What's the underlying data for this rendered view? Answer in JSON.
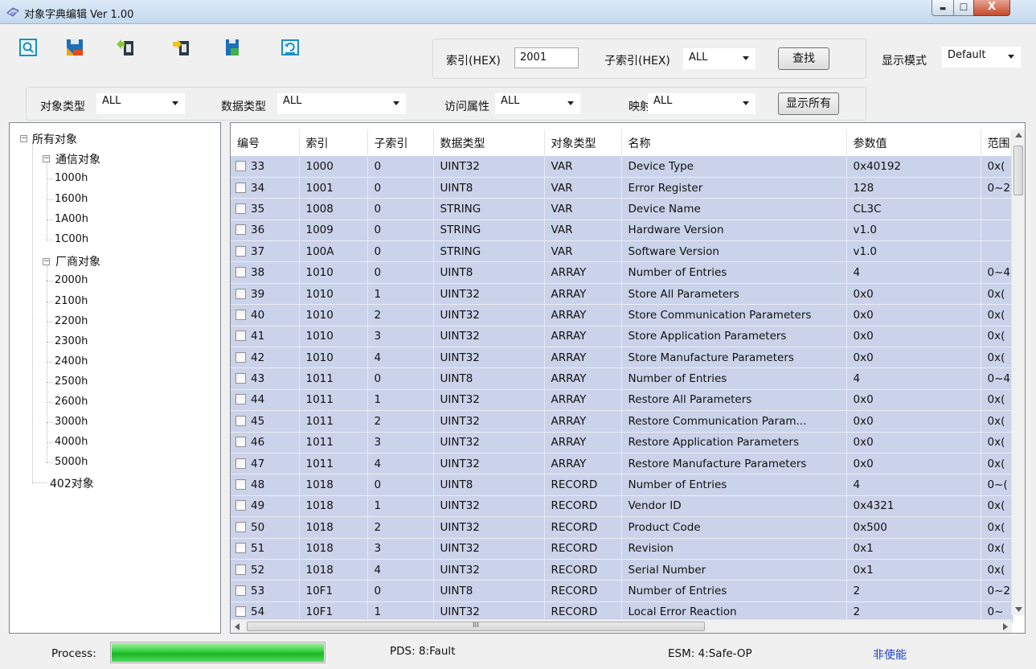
{
  "window": {
    "title": "对象字典编辑 Ver 1.00",
    "minimize_glyph": "▬",
    "maximize_glyph": "☐",
    "close_glyph": "X"
  },
  "toolbar": {
    "buttons": [
      "search-icon",
      "save-icon",
      "import-icon",
      "export-icon",
      "save-file-icon",
      "refresh-icon"
    ]
  },
  "search": {
    "index_label": "索引(HEX)",
    "index_value": "2001",
    "subindex_label": "子索引(HEX)",
    "subindex_value": "ALL",
    "find_button": "查找",
    "display_mode_label": "显示模式",
    "display_mode_value": "Default"
  },
  "filters": {
    "object_type_label": "对象类型",
    "object_type_value": "ALL",
    "data_type_label": "数据类型",
    "data_type_value": "ALL",
    "access_label": "访问属性",
    "access_value": "ALL",
    "mapping_label": "映射",
    "mapping_value": "ALL",
    "show_all_button": "显示所有"
  },
  "tree": {
    "root": "所有对象",
    "comm": "通信对象",
    "comm_children": [
      "1000h",
      "1600h",
      "1A00h",
      "1C00h"
    ],
    "vendor": "厂商对象",
    "vendor_children": [
      "2000h",
      "2100h",
      "2200h",
      "2300h",
      "2400h",
      "2500h",
      "2600h",
      "3000h",
      "4000h",
      "5000h"
    ],
    "obj402": "402对象",
    "collapse_glyph": "−"
  },
  "grid": {
    "columns": [
      "编号",
      "索引",
      "子索引",
      "数据类型",
      "对象类型",
      "名称",
      "参数值",
      "范围"
    ],
    "rows": [
      [
        "33",
        "1000",
        "0",
        "UINT32",
        "VAR",
        "Device Type",
        "0x40192",
        "0x("
      ],
      [
        "34",
        "1001",
        "0",
        "UINT8",
        "VAR",
        "Error Register",
        "128",
        "0~2"
      ],
      [
        "35",
        "1008",
        "0",
        "STRING",
        "VAR",
        "Device Name",
        "CL3C",
        ""
      ],
      [
        "36",
        "1009",
        "0",
        "STRING",
        "VAR",
        "Hardware Version",
        "v1.0",
        ""
      ],
      [
        "37",
        "100A",
        "0",
        "STRING",
        "VAR",
        "Software Version",
        "v1.0",
        ""
      ],
      [
        "38",
        "1010",
        "0",
        "UINT8",
        "ARRAY",
        "Number of Entries",
        "4",
        "0~4"
      ],
      [
        "39",
        "1010",
        "1",
        "UINT32",
        "ARRAY",
        "Store All Parameters",
        "0x0",
        "0x("
      ],
      [
        "40",
        "1010",
        "2",
        "UINT32",
        "ARRAY",
        "Store Communication Parameters",
        "0x0",
        "0x("
      ],
      [
        "41",
        "1010",
        "3",
        "UINT32",
        "ARRAY",
        "Store Application Parameters",
        "0x0",
        "0x("
      ],
      [
        "42",
        "1010",
        "4",
        "UINT32",
        "ARRAY",
        "Store Manufacture Parameters",
        "0x0",
        "0x("
      ],
      [
        "43",
        "1011",
        "0",
        "UINT8",
        "ARRAY",
        "Number of Entries",
        "4",
        "0~4"
      ],
      [
        "44",
        "1011",
        "1",
        "UINT32",
        "ARRAY",
        "Restore All Parameters",
        "0x0",
        "0x("
      ],
      [
        "45",
        "1011",
        "2",
        "UINT32",
        "ARRAY",
        "Restore Communication Param...",
        "0x0",
        "0x("
      ],
      [
        "46",
        "1011",
        "3",
        "UINT32",
        "ARRAY",
        "Restore Application Parameters",
        "0x0",
        "0x("
      ],
      [
        "47",
        "1011",
        "4",
        "UINT32",
        "ARRAY",
        "Restore Manufacture Parameters",
        "0x0",
        "0x("
      ],
      [
        "48",
        "1018",
        "0",
        "UINT8",
        "RECORD",
        "Number of Entries",
        "4",
        "0~("
      ],
      [
        "49",
        "1018",
        "1",
        "UINT32",
        "RECORD",
        "Vendor ID",
        "0x4321",
        "0x("
      ],
      [
        "50",
        "1018",
        "2",
        "UINT32",
        "RECORD",
        "Product Code",
        "0x500",
        "0x("
      ],
      [
        "51",
        "1018",
        "3",
        "UINT32",
        "RECORD",
        "Revision",
        "0x1",
        "0x("
      ],
      [
        "52",
        "1018",
        "4",
        "UINT32",
        "RECORD",
        "Serial Number",
        "0x1",
        "0x("
      ],
      [
        "53",
        "10F1",
        "0",
        "UINT8",
        "RECORD",
        "Number of Entries",
        "2",
        "0~2"
      ],
      [
        "54",
        "10F1",
        "1",
        "UINT32",
        "RECORD",
        "Local Error Reaction",
        "2",
        "0~"
      ]
    ],
    "hscroll_grip": "III"
  },
  "status": {
    "process_label": "Process:",
    "progress_fraction": 1.0,
    "pds": "PDS: 8:Fault",
    "esm": "ESM: 4:Safe-OP",
    "enable_state": "非使能",
    "enable_color": "#1f3fbf"
  }
}
